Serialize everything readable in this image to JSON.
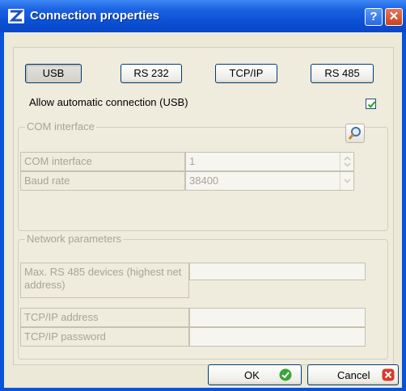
{
  "window": {
    "title": "Connection properties",
    "help_glyph": "?",
    "close_glyph": "✕"
  },
  "tabs": [
    {
      "label": "USB",
      "selected": true
    },
    {
      "label": "RS 232",
      "selected": false
    },
    {
      "label": "TCP/IP",
      "selected": false
    },
    {
      "label": "RS 485",
      "selected": false
    }
  ],
  "auto_connect": {
    "label": "Allow automatic connection (USB)",
    "checked": true
  },
  "com_group": {
    "title": "COM interface",
    "rows": [
      {
        "label": "COM interface",
        "value": "1"
      },
      {
        "label": "Baud rate",
        "value": "38400"
      }
    ]
  },
  "net_group": {
    "title": "Network parameters",
    "rows": [
      {
        "label": "Max. RS 485 devices (highest net address)",
        "value": ""
      },
      {
        "label": "TCP/IP address",
        "value": ""
      },
      {
        "label": "TCP/IP password",
        "value": ""
      }
    ]
  },
  "buttons": {
    "ok": "OK",
    "cancel": "Cancel"
  },
  "colors": {
    "title_bar": "#0a4fd4",
    "ok_icon": "#3aa63a",
    "cancel_icon": "#d93a2a",
    "disabled_text": "#a7a49a"
  },
  "icons": {
    "app": "z-logo-icon",
    "search": "magnifier-icon",
    "ok": "green-check-icon",
    "cancel": "red-x-icon"
  }
}
